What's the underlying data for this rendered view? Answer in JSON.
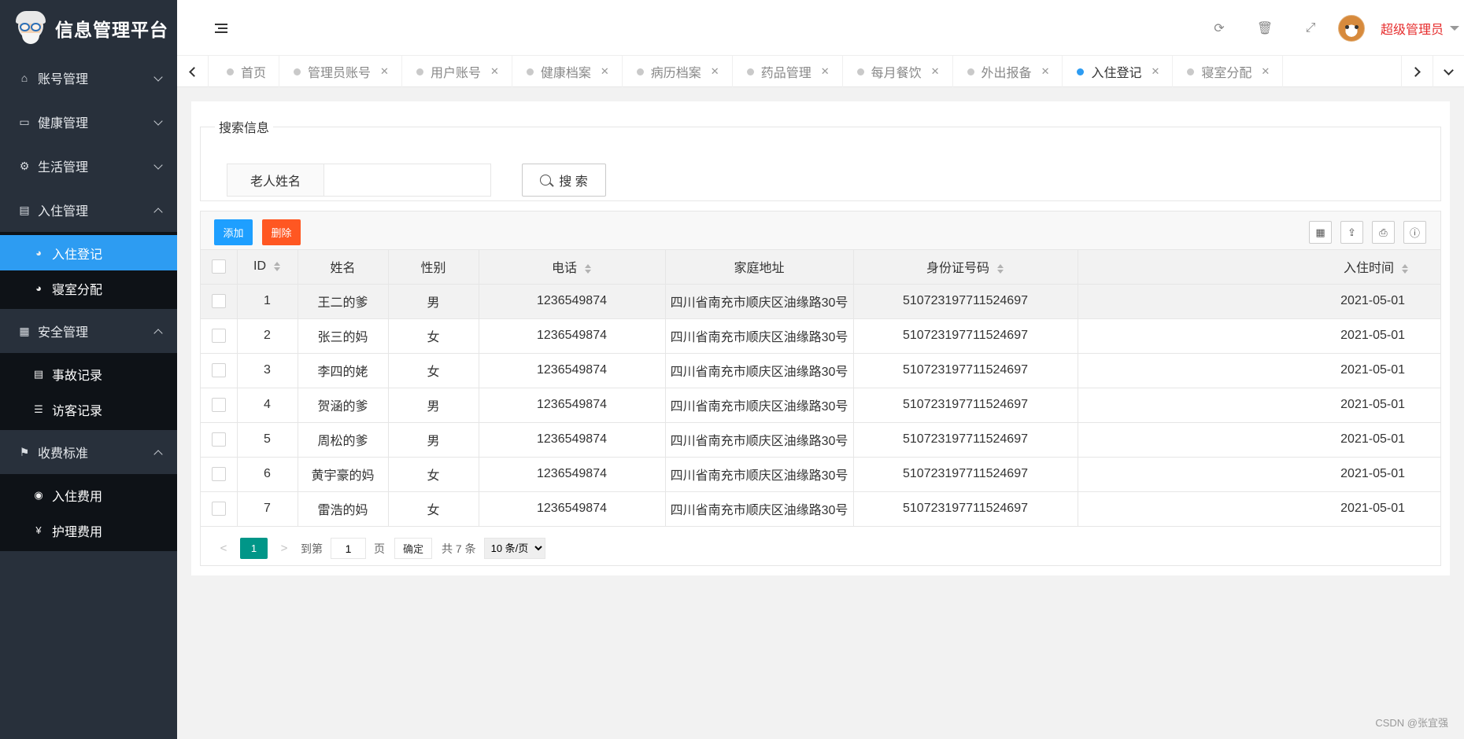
{
  "app": {
    "title": "信息管理平台"
  },
  "sidebar": {
    "groups": [
      {
        "label": "账号管理",
        "icon": "home-icon",
        "expanded": false
      },
      {
        "label": "健康管理",
        "icon": "window-icon",
        "expanded": false
      },
      {
        "label": "生活管理",
        "icon": "gears-icon",
        "expanded": false
      },
      {
        "label": "入住管理",
        "icon": "file-icon",
        "expanded": true,
        "items": [
          {
            "label": "入住登记",
            "icon": "dashboard-icon",
            "active": true
          },
          {
            "label": "寝室分配",
            "icon": "dashboard-icon"
          }
        ]
      },
      {
        "label": "安全管理",
        "icon": "calendar-icon",
        "expanded": true,
        "items": [
          {
            "label": "事故记录",
            "icon": "list-alt-icon"
          },
          {
            "label": "访客记录",
            "icon": "bars-icon"
          }
        ]
      },
      {
        "label": "收费标准",
        "icon": "flag-icon",
        "expanded": true,
        "items": [
          {
            "label": "入住费用",
            "icon": "circle-icon"
          },
          {
            "label": "护理费用",
            "icon": "yen-icon"
          }
        ]
      }
    ]
  },
  "topbar": {
    "user": "超级管理员",
    "icons": [
      "refresh-icon",
      "trash-icon",
      "fullscreen-icon"
    ]
  },
  "tabs": [
    {
      "label": "首页",
      "closable": false
    },
    {
      "label": "管理员账号",
      "closable": true
    },
    {
      "label": "用户账号",
      "closable": true
    },
    {
      "label": "健康档案",
      "closable": true
    },
    {
      "label": "病历档案",
      "closable": true
    },
    {
      "label": "药品管理",
      "closable": true
    },
    {
      "label": "每月餐饮",
      "closable": true
    },
    {
      "label": "外出报备",
      "closable": true
    },
    {
      "label": "入住登记",
      "closable": true,
      "active": true
    },
    {
      "label": "寝室分配",
      "closable": true
    }
  ],
  "search": {
    "legend": "搜索信息",
    "field_label": "老人姓名",
    "value": "",
    "placeholder": "",
    "button": "搜 索"
  },
  "toolbar": {
    "add": "添加",
    "delete": "删除"
  },
  "table": {
    "columns": [
      "ID",
      "姓名",
      "性别",
      "电话",
      "家庭地址",
      "身份证号码",
      "入住时间"
    ],
    "rows": [
      [
        "1",
        "王二的爹",
        "男",
        "1236549874",
        "四川省南充市顺庆区油缘路30号",
        "510723197711524697",
        "2021-05-01"
      ],
      [
        "2",
        "张三的妈",
        "女",
        "1236549874",
        "四川省南充市顺庆区油缘路30号",
        "510723197711524697",
        "2021-05-01"
      ],
      [
        "3",
        "李四的姥",
        "女",
        "1236549874",
        "四川省南充市顺庆区油缘路30号",
        "510723197711524697",
        "2021-05-01"
      ],
      [
        "4",
        "贺涵的爹",
        "男",
        "1236549874",
        "四川省南充市顺庆区油缘路30号",
        "510723197711524697",
        "2021-05-01"
      ],
      [
        "5",
        "周松的爹",
        "男",
        "1236549874",
        "四川省南充市顺庆区油缘路30号",
        "510723197711524697",
        "2021-05-01"
      ],
      [
        "6",
        "黄宇豪的妈",
        "女",
        "1236549874",
        "四川省南充市顺庆区油缘路30号",
        "510723197711524697",
        "2021-05-01"
      ],
      [
        "7",
        "雷浩的妈",
        "女",
        "1236549874",
        "四川省南充市顺庆区油缘路30号",
        "510723197711524697",
        "2021-05-01"
      ]
    ]
  },
  "pager": {
    "current": "1",
    "goto_prefix": "到第",
    "goto_value": "1",
    "goto_suffix": "页",
    "confirm": "确定",
    "total": "共 7 条",
    "page_size": "10 条/页"
  },
  "watermark": "CSDN @张宜强"
}
